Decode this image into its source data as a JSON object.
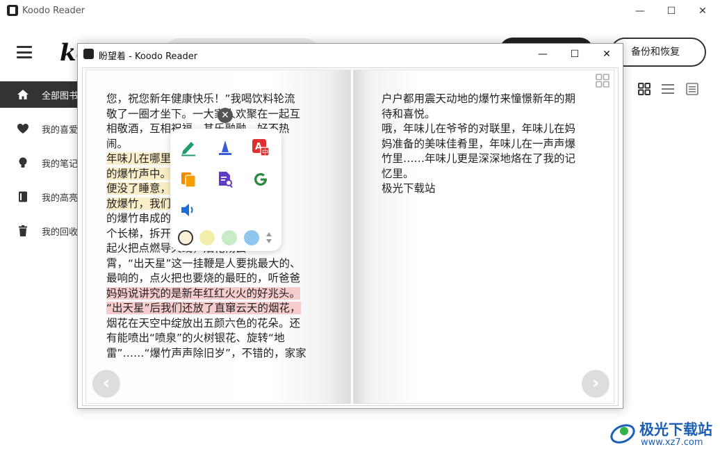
{
  "main_window": {
    "title": "Koodo Reader",
    "controls": {
      "minimize": "—",
      "maximize": "☐",
      "close": "✕"
    }
  },
  "header": {
    "logo": "koo",
    "backup_button": "备份和恢复"
  },
  "sidebar": {
    "items": [
      {
        "label": "全部图书",
        "icon": "home-icon",
        "active": true
      },
      {
        "label": "我的喜爱",
        "icon": "heart-icon",
        "active": false
      },
      {
        "label": "我的笔记",
        "icon": "bulb-icon",
        "active": false
      },
      {
        "label": "我的高亮",
        "icon": "book-icon",
        "active": false
      },
      {
        "label": "我的回收站",
        "icon": "trash-icon",
        "active": false
      }
    ]
  },
  "reader_window": {
    "title": "盼望着 - Koodo Reader",
    "controls": {
      "minimize": "—",
      "maximize": "☐",
      "close": "✕"
    }
  },
  "book": {
    "left_page": {
      "lines": [
        "您，祝您新年健康快乐！”我喝饮料轮流",
        "敬了一圈才坐下。一大家人欢聚在一起互",
        "相敬酒，互相祝福，其乐融融，好不热",
        "闹。",
        "年味儿在哪里？年味儿在那震耳欲聋",
        "的爆竹声中。除夕夜还没到，人们",
        "便没了睡意，一家人都围着要起来",
        "放爆竹，我们一起挂起了一小单个",
        "的爆竹串成的长鞭，要放就要找一",
        "个长梯，拆开包装挂在树枝上，拿",
        "起火把点燃导火线，烟花彻云",
        "霄，“出天星”这一挂鞭是人要挑最大的、",
        "最响的，点火把也要烧的最旺的，听爸爸",
        "妈妈说讲究的是新年红红火火的好兆头。",
        "“出天星”后我们还放了直窜云天的烟花，",
        "烟花在天空中绽放出五颜六色的花朵。还",
        "有能喷出“喷泉”的火树银花、旋转“地",
        "雷”……“爆竹声声除旧岁”，不错的，家家"
      ]
    },
    "right_page": {
      "lines": [
        "户户都用震天动地的爆竹来憧憬新年的期",
        "待和喜悦。",
        "哦，年味儿在爷爷的对联里，年味儿在妈",
        "妈准备的美味佳肴里，年味儿在一声声爆",
        "竹里……年味儿更是深深地烙在了我的记",
        "忆里。",
        "极光下载站"
      ]
    },
    "prev_arrow": "‹",
    "next_arrow": "›"
  },
  "popup": {
    "close": "✕",
    "actions": [
      "note-icon",
      "highlight-icon",
      "translate-icon",
      "copy-icon",
      "search-text-icon",
      "google-icon",
      "speak-icon"
    ],
    "swatch_colors": [
      "#fbf0d9",
      "#f3eeaa",
      "#c7ecc6",
      "#8fc6ef"
    ],
    "accent_colors": {
      "green": "#1e9e6a",
      "blue": "#3b5bdb",
      "red": "#e03131",
      "orange": "#f08c00",
      "purple": "#5f3dc4",
      "speaker": "#1c6fd1"
    }
  },
  "watermark": {
    "text": "极光下载站",
    "url": "www.xz7.com"
  }
}
